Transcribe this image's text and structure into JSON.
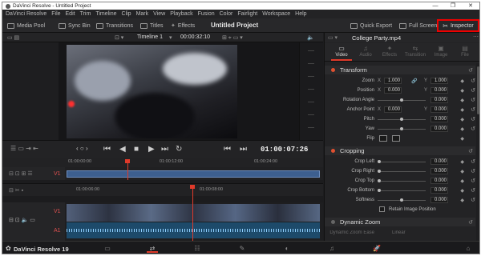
{
  "window": {
    "title": "DaVinci Resolve - Untitled Project",
    "controls": [
      "—",
      "❐",
      "✕"
    ]
  },
  "menu": [
    "DaVinci Resolve",
    "File",
    "Edit",
    "Trim",
    "Timeline",
    "Clip",
    "Mark",
    "View",
    "Playback",
    "Fusion",
    "Color",
    "Fairlight",
    "Workspace",
    "Help"
  ],
  "toolbar": {
    "media_pool": "Media Pool",
    "sync_bin": "Sync Bin",
    "transitions": "Transitions",
    "titles": "Titles",
    "effects": "Effects",
    "project_title": "Untitled Project",
    "quick_export": "Quick Export",
    "full_screen": "Full Screen",
    "inspector": "Inspector"
  },
  "viewer": {
    "timeline_name": "Timeline 1",
    "timecode_top": "00:00:32:10",
    "timecode_main": "01:00:07:26"
  },
  "timeline": {
    "ruler1": [
      "01:00:00:00",
      "01:00:12:00",
      "01:00:24:00"
    ],
    "ruler2": [
      "01:00:06:00",
      "01:00:08:00"
    ],
    "v1": "V1",
    "a1": "A1"
  },
  "inspector": {
    "clip_name": "College Party.mp4",
    "tabs": [
      {
        "label": "Video",
        "icon": "▭"
      },
      {
        "label": "Audio",
        "icon": "♫"
      },
      {
        "label": "Effects",
        "icon": "✦"
      },
      {
        "label": "Transition",
        "icon": "⇆"
      },
      {
        "label": "Image",
        "icon": "▣"
      },
      {
        "label": "File",
        "icon": "▤"
      }
    ],
    "transform": {
      "title": "Transform",
      "zoom_label": "Zoom",
      "zoom_x": "1.000",
      "zoom_y": "1.000",
      "position_label": "Position",
      "pos_x": "0.000",
      "pos_y": "0.000",
      "rotation_label": "Rotation Angle",
      "rotation": "0.000",
      "anchor_label": "Anchor Point",
      "anchor_x": "0.000",
      "anchor_y": "0.000",
      "pitch_label": "Pitch",
      "pitch": "0.000",
      "yaw_label": "Yaw",
      "yaw": "0.000",
      "flip_label": "Flip"
    },
    "cropping": {
      "title": "Cropping",
      "left_label": "Crop Left",
      "left": "0.000",
      "right_label": "Crop Right",
      "right": "0.000",
      "top_label": "Crop Top",
      "top": "0.000",
      "bottom_label": "Crop Bottom",
      "bottom": "0.000",
      "softness_label": "Softness",
      "softness": "0.000",
      "retain_label": "Retain Image Position"
    },
    "dynamic_zoom": {
      "title": "Dynamic Zoom",
      "ease_label": "Dynamic Zoom Ease",
      "ease_value": "Linear"
    }
  },
  "pagebar": {
    "brand": "DaVinci Resolve 19"
  },
  "colors": {
    "accent": "#e03a2a",
    "highlight_box": "#e00000",
    "clip_blue": "#3d5f8f"
  }
}
